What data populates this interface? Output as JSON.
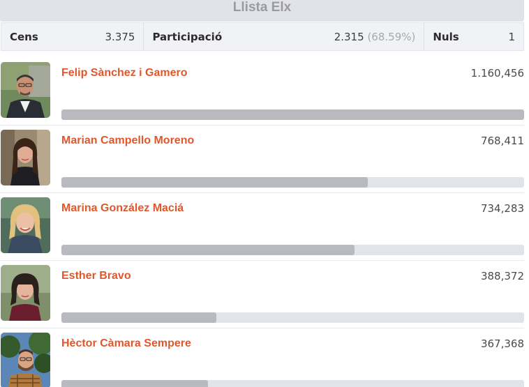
{
  "title": "Llista Elx",
  "stats": {
    "cens_label": "Cens",
    "cens_value": "3.375",
    "participacio_label": "Participació",
    "participacio_value": "2.315",
    "participacio_pct": "(68.59%)",
    "nuls_label": "Nuls",
    "nuls_value": "1"
  },
  "colors": {
    "accent": "#e0572b",
    "bar_fill": "#b9babf",
    "bar_track": "#e3e4ea",
    "header_bg": "#e2e3e8"
  },
  "candidates": [
    {
      "name": "Felip Sànchez i Gamero",
      "votes": "1.160,456",
      "share": 1.0
    },
    {
      "name": "Marian Campello Moreno",
      "votes": "768,411",
      "share": 0.662
    },
    {
      "name": "Marina González Maciá",
      "votes": "734,283",
      "share": 0.633
    },
    {
      "name": "Esther Bravo",
      "votes": "388,372",
      "share": 0.335
    },
    {
      "name": "Hèctor Càmara Sempere",
      "votes": "367,368",
      "share": 0.317
    }
  ]
}
